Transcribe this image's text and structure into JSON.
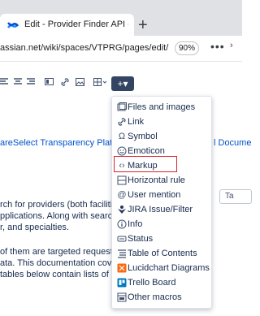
{
  "browser": {
    "tab_title": "Edit - Provider Finder API - Con",
    "new_tab": "+",
    "url_visible": "assian.net/wiki/spaces/VTPRG/pages/edit/",
    "zoom": "90%",
    "more_menu": "•••",
    "chevron": "›"
  },
  "toolbar": {
    "insert_button": "+▾"
  },
  "content": {
    "link_text": "areSelect Transparency Platform R",
    "link_right": "l Docume",
    "tag_label": "Ta",
    "lines_a": [
      "rch for providers (both facilities an",
      "pplications. Along with searching,",
      "r, and specialties."
    ],
    "lines_b": [
      "of them are targeted requests, th",
      "ata. This documentation covers ea",
      "tables below contain lists of the P"
    ]
  },
  "menu": {
    "items": [
      {
        "label": "Files and images",
        "icon": "image-icon"
      },
      {
        "label": "Link",
        "icon": "link-icon"
      },
      {
        "label": "Symbol",
        "icon": "omega-icon"
      },
      {
        "label": "Emoticon",
        "icon": "smiley-icon"
      },
      {
        "label": "Markup",
        "icon": "code-icon"
      },
      {
        "label": "Horizontal rule",
        "icon": "rule-icon"
      },
      {
        "label": "User mention",
        "icon": "at-icon"
      },
      {
        "label": "JIRA Issue/Filter",
        "icon": "jira-icon"
      },
      {
        "label": "Info",
        "icon": "info-icon"
      },
      {
        "label": "Status",
        "icon": "status-icon"
      },
      {
        "label": "Table of Contents",
        "icon": "toc-icon"
      },
      {
        "label": "Lucidchart Diagrams",
        "icon": "lucidchart-icon"
      },
      {
        "label": "Trello Board",
        "icon": "trello-icon"
      },
      {
        "label": "Other macros",
        "icon": "macro-icon"
      }
    ],
    "highlighted": "Markup"
  },
  "colors": {
    "accent": "#0052cc",
    "highlight_border": "#d9262f",
    "insert_button_bg": "#344563"
  }
}
